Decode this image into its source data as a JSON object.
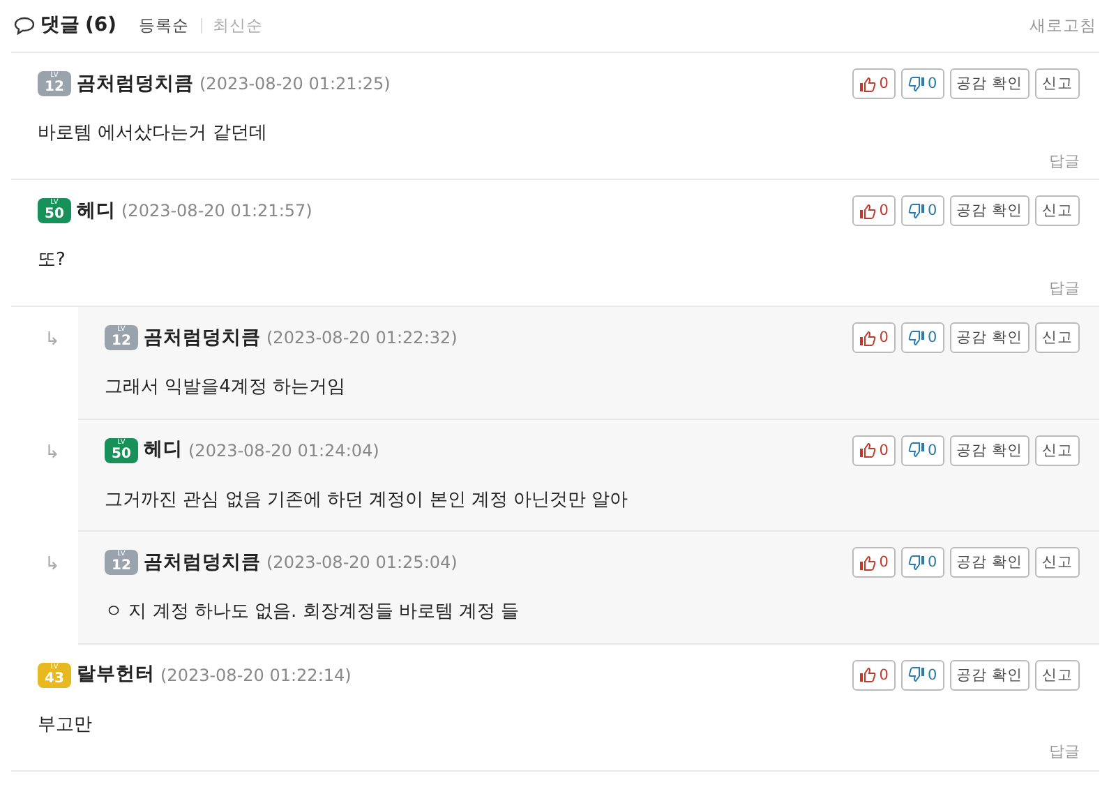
{
  "header": {
    "title": "댓글",
    "count": "(6)",
    "sort_options": [
      {
        "label": "등록순",
        "selected": true
      },
      {
        "label": "최신순",
        "selected": false
      }
    ],
    "refresh": "새로고침"
  },
  "comments": [
    {
      "author": "곰처럼덩치큼",
      "badge": {
        "lv": "LV",
        "text": "12",
        "color": "#9aa3ab"
      },
      "time": "(2023-08-20 01:21:25)",
      "text": "바로템 에서샀다는거 같던데",
      "like": "0",
      "dislike": "0",
      "empathy": "공감 확인",
      "report": "신고",
      "reply": "답글"
    },
    {
      "author": "헤디",
      "badge": {
        "lv": "LV",
        "text": "50",
        "color": "#17905a"
      },
      "time": "(2023-08-20 01:21:57)",
      "text": "또?",
      "like": "0",
      "dislike": "0",
      "empathy": "공감 확인",
      "report": "신고",
      "reply": "답글",
      "children": [
        {
          "author": "곰처럼덩치큼",
          "badge": {
            "lv": "LV",
            "text": "12",
            "color": "#9aa3ab"
          },
          "time": "(2023-08-20 01:22:32)",
          "text": "그래서 익발을4계정 하는거임",
          "like": "0",
          "dislike": "0",
          "empathy": "공감 확인",
          "report": "신고",
          "arrow": "↳"
        },
        {
          "author": "헤디",
          "badge": {
            "lv": "LV",
            "text": "50",
            "color": "#17905a"
          },
          "time": "(2023-08-20 01:24:04)",
          "text": "그거까진 관심 없음 기존에 하던 계정이 본인 계정 아닌것만 알아",
          "like": "0",
          "dislike": "0",
          "empathy": "공감 확인",
          "report": "신고",
          "arrow": "↳"
        },
        {
          "author": "곰처럼덩치큼",
          "badge": {
            "lv": "LV",
            "text": "12",
            "color": "#9aa3ab"
          },
          "time": "(2023-08-20 01:25:04)",
          "text": "ㅇ 지 계정 하나도 없음. 회장계정들 바로템 계정 들",
          "like": "0",
          "dislike": "0",
          "empathy": "공감 확인",
          "report": "신고",
          "arrow": "↳"
        }
      ]
    },
    {
      "author": "랄부헌터",
      "badge": {
        "lv": "LV",
        "text": "43",
        "color": "#e8b820"
      },
      "time": "(2023-08-20 01:22:14)",
      "text": "부고만",
      "like": "0",
      "dislike": "0",
      "empathy": "공감 확인",
      "report": "신고",
      "reply": "답글"
    }
  ]
}
